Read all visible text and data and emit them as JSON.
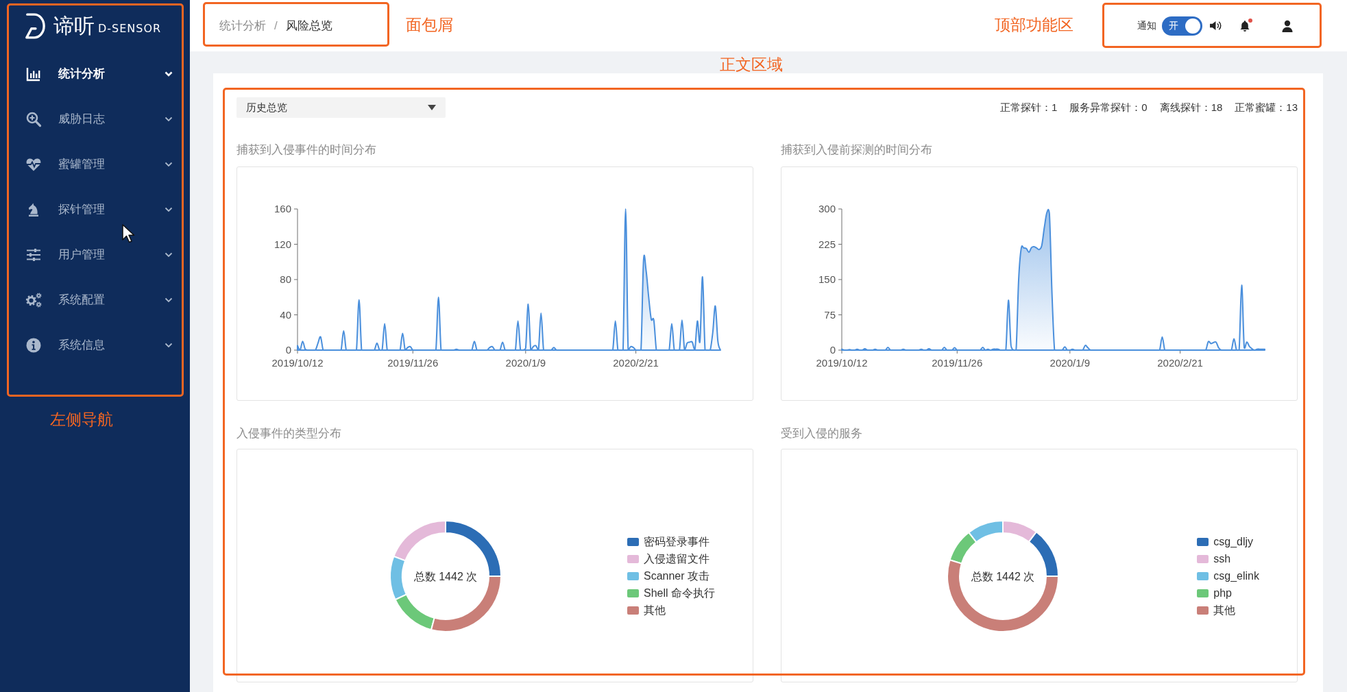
{
  "sidebar": {
    "logo": {
      "title": "谛听",
      "subtitle": "D-SENSOR"
    },
    "items": [
      {
        "label": "统计分析",
        "selected": true
      },
      {
        "label": "威胁日志",
        "selected": false
      },
      {
        "label": "蜜罐管理",
        "selected": false
      },
      {
        "label": "探针管理",
        "selected": false
      },
      {
        "label": "用户管理",
        "selected": false
      },
      {
        "label": "系统配置",
        "selected": false
      },
      {
        "label": "系统信息",
        "selected": false
      }
    ]
  },
  "header": {
    "breadcrumb": [
      {
        "label": "统计分析",
        "current": false
      },
      {
        "label": "风险总览",
        "current": true
      }
    ],
    "breadcrumb_separator": "/",
    "notify": {
      "label": "通知",
      "switch_text": "开",
      "on": true
    },
    "bell": {
      "unread": true
    }
  },
  "content": {
    "range_select": {
      "value": "历史总览"
    },
    "stats": [
      "正常探针：1",
      "服务异常探针：0",
      "离线探针：18",
      "正常蜜罐：13"
    ],
    "line_charts": [
      {
        "chart_data": {
          "type": "area",
          "title": "捕获到入侵事件的时间分布",
          "categories": [
            "2019/10/12",
            null,
            null,
            null,
            null,
            null,
            null,
            null,
            null,
            null,
            null,
            null,
            null,
            null,
            null,
            null,
            null,
            null,
            null,
            null,
            null,
            null,
            null,
            null,
            null,
            null,
            null,
            null,
            null,
            null,
            null,
            null,
            null,
            null,
            null,
            null,
            null,
            null,
            null,
            null,
            null,
            null,
            null,
            null,
            null,
            "2019/11/26",
            null,
            null,
            null,
            null,
            null,
            null,
            null,
            null,
            null,
            null,
            null,
            null,
            null,
            null,
            null,
            null,
            null,
            null,
            null,
            null,
            null,
            null,
            null,
            null,
            null,
            null,
            null,
            null,
            null,
            null,
            null,
            null,
            null,
            null,
            null,
            null,
            null,
            null,
            null,
            null,
            null,
            null,
            null,
            "2020/1/9",
            null,
            null,
            null,
            null,
            null,
            null,
            null,
            null,
            null,
            null,
            null,
            null,
            null,
            null,
            null,
            null,
            null,
            null,
            null,
            null,
            null,
            null,
            null,
            null,
            null,
            null,
            null,
            null,
            null,
            null,
            null,
            null,
            null,
            null,
            null,
            null,
            null,
            null,
            null,
            null,
            null,
            null,
            "2020/2/21",
            null,
            null,
            null,
            null,
            null,
            null,
            null,
            null,
            null,
            null,
            null,
            null,
            null,
            null,
            null,
            null,
            null,
            null,
            null,
            null,
            null,
            null,
            null,
            null,
            null,
            null,
            null,
            null,
            null,
            null,
            null,
            null,
            null
          ],
          "ylim": [
            0,
            160
          ],
          "yticks": [
            0,
            40,
            80,
            120,
            160
          ],
          "values": [
            5,
            0,
            10,
            1,
            0,
            0,
            0,
            0,
            8,
            15,
            0,
            0,
            0,
            0,
            0,
            0,
            0,
            0,
            22,
            0,
            0,
            0,
            0,
            0,
            57,
            0,
            0,
            0,
            0,
            0,
            0,
            8,
            0,
            0,
            30,
            0,
            0,
            0,
            0,
            0,
            0,
            19,
            0,
            3,
            4,
            0,
            0,
            0,
            0,
            0,
            0,
            0,
            0,
            0,
            0,
            60,
            0,
            0,
            0,
            0,
            0,
            0,
            1,
            0,
            0,
            0,
            0,
            0,
            0,
            10,
            0,
            0,
            0,
            0,
            0,
            3,
            4,
            0,
            0,
            0,
            9,
            0,
            0,
            0,
            0,
            0,
            33,
            0,
            0,
            2,
            52,
            0,
            4,
            5,
            0,
            42,
            0,
            0,
            0,
            0,
            3,
            0,
            0,
            0,
            0,
            0,
            0,
            0,
            0,
            0,
            0,
            0,
            0,
            0,
            0,
            0,
            0,
            0,
            0,
            0,
            0,
            0,
            0,
            0,
            33,
            0,
            0,
            0,
            160,
            0,
            4,
            3,
            0,
            0,
            0,
            102,
            90,
            60,
            35,
            34,
            0,
            0,
            0,
            0,
            0,
            0,
            30,
            0,
            0,
            0,
            34,
            0,
            8,
            9,
            9,
            0,
            33,
            10,
            83,
            0,
            0,
            0,
            20,
            50,
            10,
            0
          ]
        }
      },
      {
        "chart_data": {
          "type": "area",
          "title": "捕获到入侵前探测的时间分布",
          "categories": [
            "2019/10/12",
            null,
            null,
            null,
            null,
            null,
            null,
            null,
            null,
            null,
            null,
            null,
            null,
            null,
            null,
            null,
            null,
            null,
            null,
            null,
            null,
            null,
            null,
            null,
            null,
            null,
            null,
            null,
            null,
            null,
            null,
            null,
            null,
            null,
            null,
            null,
            null,
            null,
            null,
            null,
            null,
            null,
            null,
            null,
            null,
            "2019/11/26",
            null,
            null,
            null,
            null,
            null,
            null,
            null,
            null,
            null,
            null,
            null,
            null,
            null,
            null,
            null,
            null,
            null,
            null,
            null,
            null,
            null,
            null,
            null,
            null,
            null,
            null,
            null,
            null,
            null,
            null,
            null,
            null,
            null,
            null,
            null,
            null,
            null,
            null,
            null,
            null,
            null,
            null,
            null,
            "2020/1/9",
            null,
            null,
            null,
            null,
            null,
            null,
            null,
            null,
            null,
            null,
            null,
            null,
            null,
            null,
            null,
            null,
            null,
            null,
            null,
            null,
            null,
            null,
            null,
            null,
            null,
            null,
            null,
            null,
            null,
            null,
            null,
            null,
            null,
            null,
            null,
            null,
            null,
            null,
            null,
            null,
            null,
            null,
            "2020/2/21",
            null,
            null,
            null,
            null,
            null,
            null,
            null,
            null,
            null,
            null,
            null,
            null,
            null,
            null,
            null,
            null,
            null,
            null,
            null,
            null,
            null,
            null,
            null,
            null,
            null,
            null,
            null,
            null,
            null,
            null,
            null,
            null,
            null
          ],
          "ylim": [
            0,
            300
          ],
          "yticks": [
            0,
            75,
            150,
            225,
            300
          ],
          "values": [
            2,
            0,
            0,
            1,
            0,
            0,
            2,
            0,
            0,
            3,
            0,
            0,
            0,
            2,
            0,
            0,
            0,
            0,
            6,
            0,
            0,
            0,
            0,
            0,
            2,
            0,
            0,
            0,
            0,
            0,
            0,
            2,
            0,
            0,
            3,
            0,
            0,
            0,
            0,
            0,
            6,
            0,
            0,
            0,
            5,
            0,
            0,
            0,
            0,
            0,
            0,
            0,
            0,
            0,
            0,
            6,
            0,
            2,
            0,
            2,
            2,
            2,
            0,
            0,
            0,
            106,
            10,
            0,
            0,
            150,
            216,
            217,
            216,
            208,
            218,
            220,
            217,
            214,
            222,
            260,
            292,
            290,
            120,
            0,
            0,
            0,
            0,
            7,
            0,
            0,
            2,
            0,
            0,
            0,
            0,
            10,
            5,
            0,
            0,
            0,
            0,
            0,
            0,
            0,
            0,
            0,
            0,
            0,
            0,
            0,
            0,
            0,
            0,
            0,
            0,
            0,
            0,
            0,
            0,
            0,
            0,
            0,
            0,
            0,
            0,
            28,
            0,
            0,
            0,
            0,
            0,
            0,
            0,
            0,
            0,
            0,
            0,
            0,
            0,
            0,
            0,
            0,
            0,
            18,
            14,
            16,
            17,
            5,
            0,
            0,
            0,
            0,
            0,
            24,
            0,
            0,
            138,
            5,
            17,
            8,
            3,
            0,
            2,
            2,
            2,
            2
          ]
        }
      }
    ],
    "donut_charts": [
      {
        "title": "入侵事件的类型分布",
        "center_text": "总数 1442 次",
        "legend": [
          {
            "label": "密码登录事件",
            "color": "#2c6db5"
          },
          {
            "label": "入侵遗留文件",
            "color": "#e4b9d9"
          },
          {
            "label": "Scanner 攻击",
            "color": "#6fbfe4"
          },
          {
            "label": "Shell 命令执行",
            "color": "#6cc879"
          },
          {
            "label": "其他",
            "color": "#c97f78"
          }
        ]
      },
      {
        "title": "受到入侵的服务",
        "center_text": "总数 1442 次",
        "legend": [
          {
            "label": "csg_dljy",
            "color": "#2c6db5"
          },
          {
            "label": "ssh",
            "color": "#e4b9d9"
          },
          {
            "label": "csg_elink",
            "color": "#6fbfe4"
          },
          {
            "label": "php",
            "color": "#6cc879"
          },
          {
            "label": "其他",
            "color": "#c97f78"
          }
        ]
      }
    ]
  },
  "annotations": [
    {
      "label": "面包屑"
    },
    {
      "label": "顶部功能区"
    },
    {
      "label": "正文区域"
    },
    {
      "label": "左侧导航"
    }
  ]
}
